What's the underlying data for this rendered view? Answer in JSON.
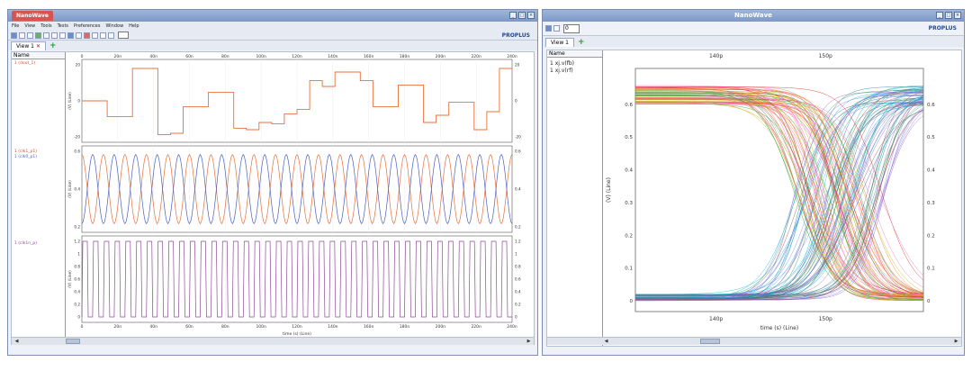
{
  "left_window": {
    "title": "NanoWave",
    "menu": [
      "File",
      "View",
      "Tools",
      "Tests",
      "Preferences",
      "Window",
      "Help"
    ],
    "logo": "PROPLUS",
    "tab_label": "View 1",
    "name_header": "Name",
    "signals": [
      "1 (dout_1)",
      "1 (clk1_p1)",
      "1 (clk0_p1)",
      "1 (clk1n_p)"
    ],
    "time_ticks": [
      "0",
      "20n",
      "40n",
      "60n",
      "80n",
      "100n",
      "120n",
      "140n",
      "160n",
      "180n",
      "200n",
      "220n",
      "240n"
    ],
    "panel1": {
      "ylabel": "(V) (Line)",
      "ticks": [
        "20",
        "0",
        "-20"
      ]
    },
    "panel2": {
      "ylabel": "(V) (Line)",
      "ticks": [
        "0.6",
        "0.4",
        "0.2"
      ]
    },
    "panel3": {
      "ylabel": "(V) (Line)",
      "ticks": [
        "1.2",
        "1",
        "0.8",
        "0.6",
        "0.4",
        "0.2",
        "0"
      ]
    },
    "xlabel": "time (s) (Line)",
    "colors": {
      "orange": "#e8703a",
      "blue": "#4b5fbf",
      "purple": "#8c4b96"
    }
  },
  "right_window": {
    "title": "NanoWave",
    "logo": "PROPLUS",
    "toolbar_input": "0",
    "tab_label": "View 1",
    "name_header": "Name",
    "signals": [
      "1 xj.v(fb)",
      "1 xj.v(rf)"
    ],
    "top_ticks": [
      "140p",
      "150p"
    ],
    "bottom_ticks": [
      "140p",
      "150p"
    ],
    "y_ticks": [
      "0.6",
      "0.5",
      "0.4",
      "0.3",
      "0.2",
      "0.1",
      "0"
    ],
    "ylabel": "(V) (Line)",
    "xlabel": "time (s) (Line)"
  }
}
